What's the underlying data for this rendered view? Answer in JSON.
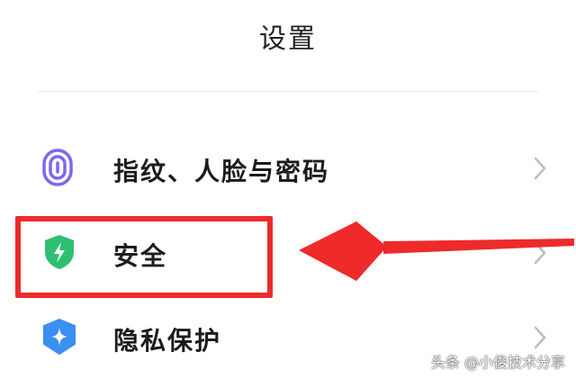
{
  "header": {
    "title": "设置"
  },
  "settings": {
    "items": [
      {
        "label": "指纹、人脸与密码",
        "icon": "fingerprint-icon",
        "color": "#7b68ee"
      },
      {
        "label": "安全",
        "icon": "security-shield-icon",
        "color": "#2fbf71"
      },
      {
        "label": "隐私保护",
        "icon": "privacy-shield-icon",
        "color": "#3b8ff0"
      }
    ]
  },
  "annotation": {
    "box_color": "#ee2a2a",
    "arrow_color": "#ee2a2a"
  },
  "watermark": {
    "text": "头条 @小俊技术分享"
  }
}
